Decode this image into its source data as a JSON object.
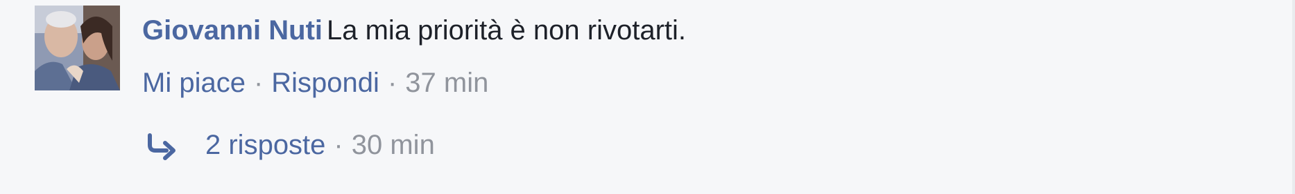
{
  "comment": {
    "author": "Giovanni Nuti",
    "text": "La mia priorità è non rivotarti.",
    "actions": {
      "like_label": "Mi piace",
      "reply_label": "Rispondi",
      "separator": "·",
      "timestamp": "37 min"
    },
    "replies": {
      "icon": "reply-arrow-icon",
      "label": "2 risposte",
      "separator": "·",
      "timestamp": "30 min"
    },
    "colors": {
      "link": "#4b67a1",
      "text": "#1d2129",
      "muted": "#90949c",
      "background": "#f6f7f9"
    }
  }
}
